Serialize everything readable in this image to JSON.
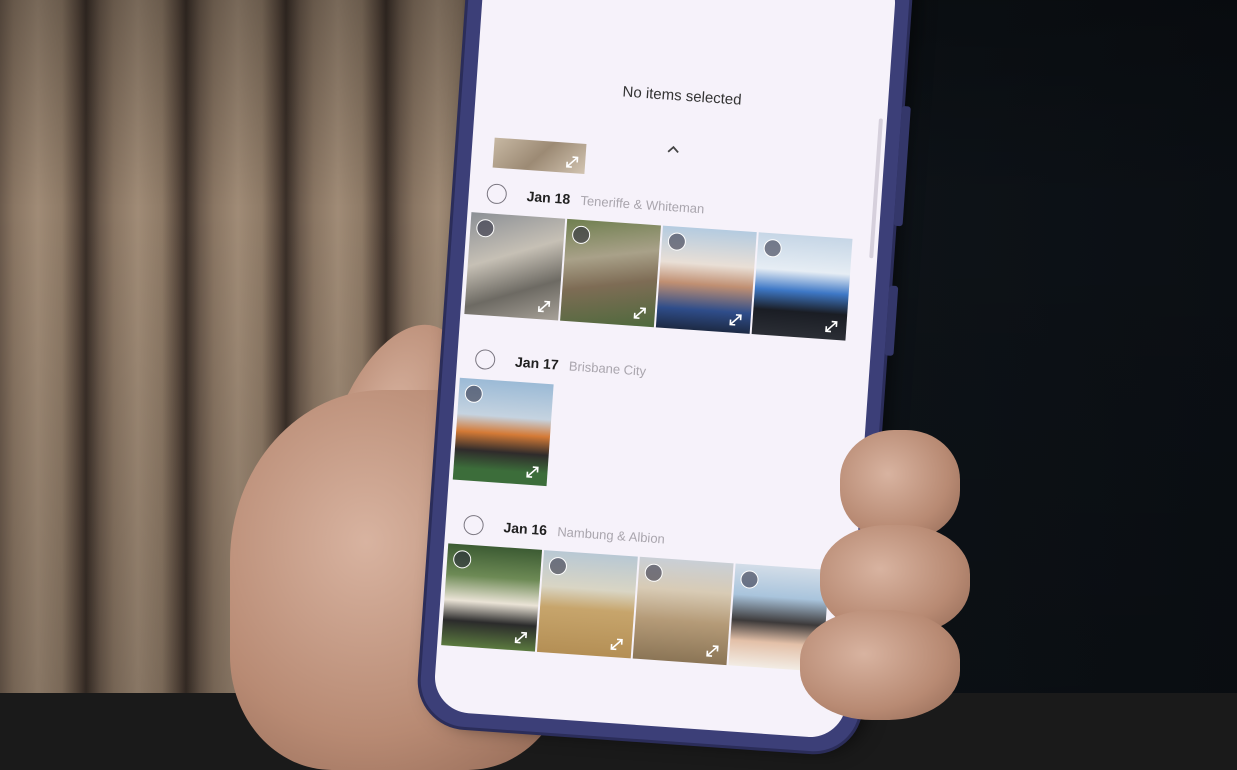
{
  "header": {
    "selection_status": "No items selected",
    "collapse_icon": "chevron-up-icon"
  },
  "groups": [
    {
      "date": "Jan 18",
      "place": "Teneriffe & Whiteman",
      "photo_count": 4
    },
    {
      "date": "Jan 17",
      "place": "Brisbane City",
      "photo_count": 1
    },
    {
      "date": "Jan 16",
      "place": "Nambung & Albion",
      "photo_count": 4
    }
  ],
  "icons": {
    "select": "radio-circle-icon",
    "expand": "expand-arrows-icon"
  },
  "colors": {
    "screen_background": "#f6f2fa",
    "phone_frame": "#3c3f78",
    "place_text": "#a9a5ad"
  }
}
